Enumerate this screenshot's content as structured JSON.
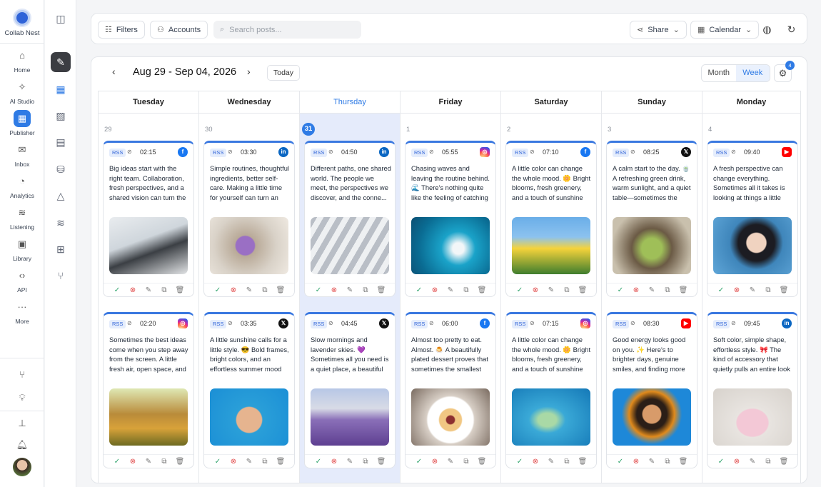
{
  "app": {
    "brand": "Collab Nest"
  },
  "nav": [
    {
      "label": "Home",
      "icon": "home-icon",
      "glyph": "⌂"
    },
    {
      "label": "AI Studio",
      "icon": "sparkle-icon",
      "glyph": "✧"
    },
    {
      "label": "Publisher",
      "icon": "calendar-icon",
      "glyph": "▦",
      "active": true
    },
    {
      "label": "Inbox",
      "icon": "inbox-icon",
      "glyph": "✉"
    },
    {
      "label": "Analytics",
      "icon": "pie-chart-icon",
      "glyph": "◔"
    },
    {
      "label": "Listening",
      "icon": "rss-icon",
      "glyph": "≋"
    },
    {
      "label": "Library",
      "icon": "image-library-icon",
      "glyph": "▣"
    },
    {
      "label": "API",
      "icon": "code-icon",
      "glyph": "‹›"
    },
    {
      "label": "More",
      "icon": "more-icon",
      "glyph": "···"
    }
  ],
  "toolbar": {
    "filters": "Filters",
    "accounts": "Accounts",
    "search_placeholder": "Search posts...",
    "share": "Share",
    "calendar": "Calendar"
  },
  "calendar": {
    "range": "Aug 29 - Sep 04, 2026",
    "today": "Today",
    "view_month": "Month",
    "view_week": "Week",
    "settings_badge": "4",
    "days": [
      {
        "name": "Tuesday",
        "num": "29"
      },
      {
        "name": "Wednesday",
        "num": "30"
      },
      {
        "name": "Thursday",
        "num": "31",
        "current": true
      },
      {
        "name": "Friday",
        "num": "1"
      },
      {
        "name": "Saturday",
        "num": "2"
      },
      {
        "name": "Sunday",
        "num": "3"
      },
      {
        "name": "Monday",
        "num": "4"
      }
    ]
  },
  "posts": [
    [
      {
        "tag": "RSS",
        "time": "02:15",
        "network": "facebook",
        "text": "Big ideas start with the right team. Collaboration, fresh perspectives, and a shared vision can turn the next ambitious proj...",
        "image": "team-meeting-photo"
      },
      {
        "tag": "RSS",
        "time": "02:20",
        "network": "instagram",
        "text": "Sometimes the best ideas come when you step away from the screen. A little fresh air, open space, and time to...",
        "image": "woman-in-flower-field-photo"
      }
    ],
    [
      {
        "tag": "RSS",
        "time": "03:30",
        "network": "linkedin",
        "text": "Simple routines, thoughtful ingredients, better self-care. Making a little time for yourself can turn an everyday ski...",
        "image": "serum-bottle-photo"
      },
      {
        "tag": "RSS",
        "time": "03:35",
        "network": "x",
        "text": "A little sunshine calls for a little style. 😎 Bold frames, bright colors, and an effortless summer mood make the perfect...",
        "image": "woman-sunglasses-photo"
      }
    ],
    [
      {
        "tag": "RSS",
        "time": "04:50",
        "network": "linkedin",
        "text": "Different paths, one shared world. The people we meet, the perspectives we discover, and the conne...",
        "image": "crosswalk-people-photo"
      },
      {
        "tag": "RSS",
        "time": "04:45",
        "network": "x",
        "text": "Slow mornings and lavender skies. 💜 Sometimes all you need is a quiet place, a beautiful view, and a mo...",
        "image": "lavender-field-photo"
      }
    ],
    [
      {
        "tag": "RSS",
        "time": "05:55",
        "network": "instagram",
        "text": "Chasing waves and leaving the routine behind. 🌊 There's nothing quite like the feeling of catching the p...",
        "image": "surfer-wave-photo"
      },
      {
        "tag": "RSS",
        "time": "06:00",
        "network": "facebook",
        "text": "Almost too pretty to eat. Almost. 🍮 A beautifully plated dessert proves that sometimes the smallest details can tur...",
        "image": "plated-dessert-photo"
      }
    ],
    [
      {
        "tag": "RSS",
        "time": "07:10",
        "network": "facebook",
        "text": "A little color can change the whole mood. 🌼 Bright blooms, fresh greenery, and a touch of sunshine are an easy re...",
        "image": "yellow-flowers-photo"
      },
      {
        "tag": "RSS",
        "time": "07:15",
        "network": "instagram",
        "text": "A little color can change the whole mood. 🌼 Bright blooms, fresh greenery, and a touch of sunshine are an easy re...",
        "image": "tube-in-water-photo"
      }
    ],
    [
      {
        "tag": "RSS",
        "time": "08:25",
        "network": "x",
        "text": "A calm start to the day. 🍵 A refreshing green drink, warm sunlight, and a quiet table—sometimes the simplest routines ar...",
        "image": "matcha-drink-photo"
      },
      {
        "tag": "RSS",
        "time": "08:30",
        "network": "youtube",
        "text": "Good energy looks good on you. ✨ Here's to brighter days, genuine smiles, and finding more reasons to enjoy the mo...",
        "image": "smiling-woman-photo"
      }
    ],
    [
      {
        "tag": "RSS",
        "time": "09:40",
        "network": "youtube",
        "text": "A fresh perspective can change everything. Sometimes all it takes is looking at things a little differently to find the id...",
        "image": "woman-glasses-photo"
      },
      {
        "tag": "RSS",
        "time": "09:45",
        "network": "linkedin",
        "text": "Soft color, simple shape, effortless style. 🎀 The kind of accessory that quietly pulls an entire look together without tr...",
        "image": "pink-handbag-photo"
      }
    ]
  ],
  "network_glyphs": {
    "facebook": "f",
    "linkedin": "in",
    "instagram": "◎",
    "x": "𝕏",
    "youtube": "▶"
  },
  "colors": {
    "accent": "#2f7be5",
    "approve": "#2ea36b",
    "reject": "#e14b4b"
  }
}
